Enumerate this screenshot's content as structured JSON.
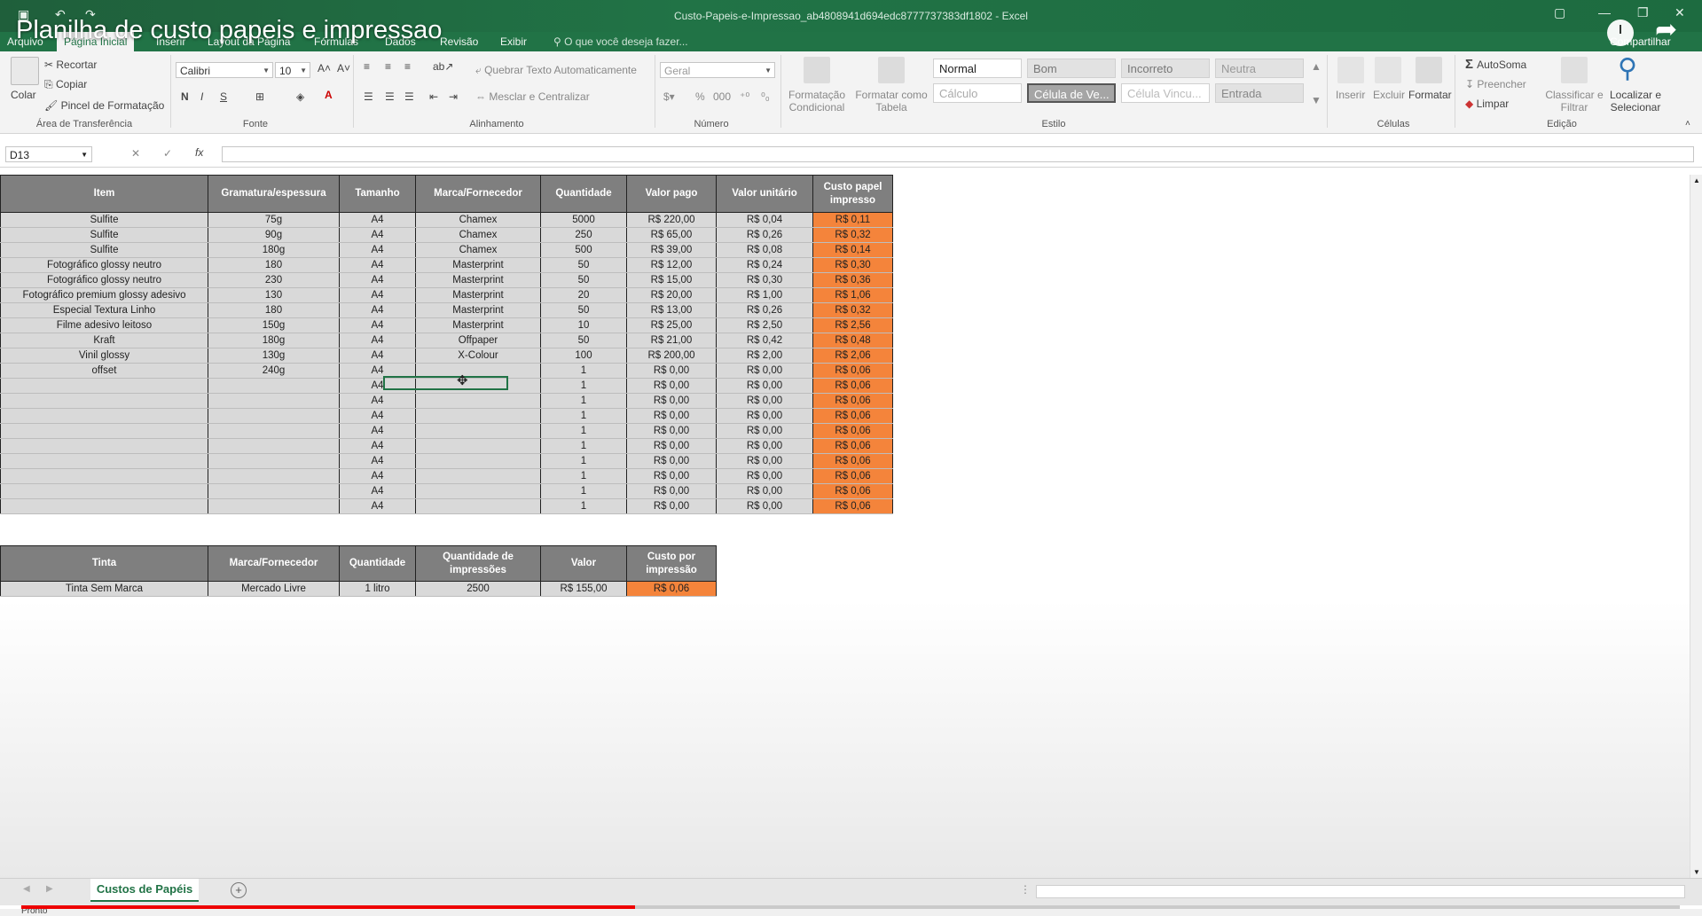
{
  "video": {
    "title": "Planilha de custo papeis e impressao",
    "progress_fraction": 0.37
  },
  "window": {
    "title": "Custo-Papeis-e-Impressao_ab4808941d694edc8777737383df1802 - Excel"
  },
  "menu": {
    "tabs": [
      "Arquivo",
      "Página Inicial",
      "Inserir",
      "Layout da Página",
      "Fórmulas",
      "Dados",
      "Revisão",
      "Exibir"
    ],
    "tell_me": "O que você deseja fazer...",
    "share": "Compartilhar"
  },
  "ribbon": {
    "clipboard": {
      "paste": "Colar",
      "cut": "Recortar",
      "copy": "Copiar",
      "format_painter": "Pincel de Formatação",
      "label": "Área de Transferência"
    },
    "font": {
      "name": "Calibri",
      "size": "10",
      "bold": "N",
      "italic": "I",
      "underline": "S",
      "label": "Fonte"
    },
    "alignment": {
      "wrap": "Quebrar Texto Automaticamente",
      "merge": "Mesclar e Centralizar",
      "label": "Alinhamento"
    },
    "number": {
      "format": "Geral",
      "label": "Número"
    },
    "styles": {
      "conditional": "Formatação Condicional",
      "format_table": "Formatar como Tabela",
      "cells": [
        "Normal",
        "Bom",
        "Incorreto",
        "Neutra",
        "Cálculo",
        "Célula de Ve...",
        "Célula Vincu...",
        "Entrada"
      ],
      "label": "Estilo"
    },
    "cells": {
      "insert": "Inserir",
      "delete": "Excluir",
      "format": "Formatar",
      "label": "Células"
    },
    "editing": {
      "autosum": "AutoSoma",
      "fill": "Preencher",
      "clear": "Limpar",
      "sort": "Classificar e Filtrar",
      "find": "Localizar e Selecionar",
      "label": "Edição"
    }
  },
  "formula_bar": {
    "name_box": "D13",
    "fx": "fx",
    "value": ""
  },
  "paper_table": {
    "headers": [
      "Item",
      "Gramatura/espessura",
      "Tamanho",
      "Marca/Fornecedor",
      "Quantidade",
      "Valor pago",
      "Valor unitário",
      "Custo papel impresso"
    ],
    "rows": [
      [
        "Sulfite",
        "75g",
        "A4",
        "Chamex",
        "5000",
        "R$ 220,00",
        "R$ 0,04",
        "R$ 0,11"
      ],
      [
        "Sulfite",
        "90g",
        "A4",
        "Chamex",
        "250",
        "R$ 65,00",
        "R$ 0,26",
        "R$ 0,32"
      ],
      [
        "Sulfite",
        "180g",
        "A4",
        "Chamex",
        "500",
        "R$ 39,00",
        "R$ 0,08",
        "R$ 0,14"
      ],
      [
        "Fotográfico glossy neutro",
        "180",
        "A4",
        "Masterprint",
        "50",
        "R$ 12,00",
        "R$ 0,24",
        "R$ 0,30"
      ],
      [
        "Fotográfico glossy neutro",
        "230",
        "A4",
        "Masterprint",
        "50",
        "R$ 15,00",
        "R$ 0,30",
        "R$ 0,36"
      ],
      [
        "Fotográfico premium glossy adesivo",
        "130",
        "A4",
        "Masterprint",
        "20",
        "R$ 20,00",
        "R$ 1,00",
        "R$ 1,06"
      ],
      [
        "Especial Textura Linho",
        "180",
        "A4",
        "Masterprint",
        "50",
        "R$ 13,00",
        "R$ 0,26",
        "R$ 0,32"
      ],
      [
        "Filme adesivo leitoso",
        "150g",
        "A4",
        "Masterprint",
        "10",
        "R$ 25,00",
        "R$ 2,50",
        "R$ 2,56"
      ],
      [
        "Kraft",
        "180g",
        "A4",
        "Offpaper",
        "50",
        "R$ 21,00",
        "R$ 0,42",
        "R$ 0,48"
      ],
      [
        "Vinil glossy",
        "130g",
        "A4",
        "X-Colour",
        "100",
        "R$ 200,00",
        "R$ 2,00",
        "R$ 2,06"
      ],
      [
        "offset",
        "240g",
        "A4",
        "",
        "1",
        "R$ 0,00",
        "R$ 0,00",
        "R$ 0,06"
      ],
      [
        "",
        "",
        "A4",
        "",
        "1",
        "R$ 0,00",
        "R$ 0,00",
        "R$ 0,06"
      ],
      [
        "",
        "",
        "A4",
        "",
        "1",
        "R$ 0,00",
        "R$ 0,00",
        "R$ 0,06"
      ],
      [
        "",
        "",
        "A4",
        "",
        "1",
        "R$ 0,00",
        "R$ 0,00",
        "R$ 0,06"
      ],
      [
        "",
        "",
        "A4",
        "",
        "1",
        "R$ 0,00",
        "R$ 0,00",
        "R$ 0,06"
      ],
      [
        "",
        "",
        "A4",
        "",
        "1",
        "R$ 0,00",
        "R$ 0,00",
        "R$ 0,06"
      ],
      [
        "",
        "",
        "A4",
        "",
        "1",
        "R$ 0,00",
        "R$ 0,00",
        "R$ 0,06"
      ],
      [
        "",
        "",
        "A4",
        "",
        "1",
        "R$ 0,00",
        "R$ 0,00",
        "R$ 0,06"
      ],
      [
        "",
        "",
        "A4",
        "",
        "1",
        "R$ 0,00",
        "R$ 0,00",
        "R$ 0,06"
      ],
      [
        "",
        "",
        "A4",
        "",
        "1",
        "R$ 0,00",
        "R$ 0,00",
        "R$ 0,06"
      ]
    ]
  },
  "ink_table": {
    "headers": [
      "Tinta",
      "Marca/Fornecedor",
      "Quantidade",
      "Quantidade de impressões",
      "Valor",
      "Custo por impressão"
    ],
    "rows": [
      [
        "Tinta Sem Marca",
        "Mercado Livre",
        "1 litro",
        "2500",
        "R$ 155,00",
        "R$ 0,06"
      ]
    ]
  },
  "sheet_tabs": {
    "active": "Custos de Papéis"
  },
  "status": {
    "text": "Pronto"
  },
  "colors": {
    "excel_green": "#217346",
    "cost_orange": "#f4843b",
    "header_gray": "#7f7f7f",
    "cell_gray": "#d9d9d9"
  }
}
